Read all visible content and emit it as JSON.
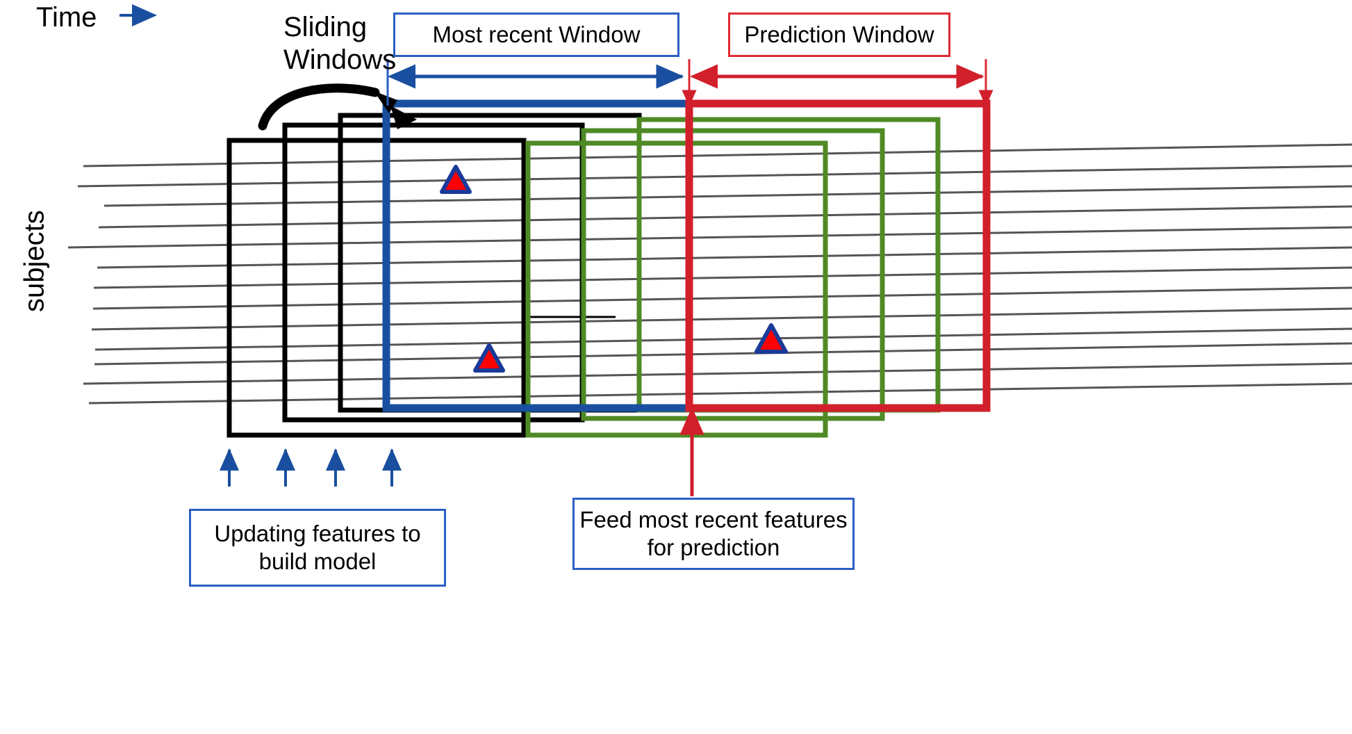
{
  "diagram": {
    "title_labels": {
      "time": "Time",
      "sliding_windows": "Sliding\nWindows",
      "subjects": "subjects"
    },
    "callout_boxes": [
      {
        "id": "most-recent-window",
        "text": "Most recent Window",
        "border_color": "#2b5ec4"
      },
      {
        "id": "prediction-window",
        "text": "Prediction Window",
        "border_color": "#e02a32"
      },
      {
        "id": "updating-features",
        "text": "Updating features\nto build model",
        "border_color": "#2b5ec4"
      },
      {
        "id": "feed-most-recent",
        "text": "Feed most recent\nfeatures for prediction",
        "border_color": "#2b5ec4"
      }
    ],
    "colors": {
      "blue": "#1a4fa0",
      "blue_accent": "#2b5ec4",
      "red": "#d11f2b",
      "red_accent": "#e02a32",
      "green": "#4f8a25",
      "black": "#000000",
      "line_gray": "#555555",
      "triangle_fill": "#ff0000",
      "triangle_stroke": "#1a3a99"
    },
    "subject_lines": {
      "count": 13,
      "description": "horizontal time-series tracks, one per subject"
    },
    "windows": [
      {
        "id": "black-window-1",
        "color": "#000000",
        "role": "training sliding window"
      },
      {
        "id": "black-window-2",
        "color": "#000000",
        "role": "training sliding window"
      },
      {
        "id": "black-window-3",
        "color": "#000000",
        "role": "training sliding window"
      },
      {
        "id": "blue-window",
        "color": "#1a4fa0",
        "role": "most recent window"
      },
      {
        "id": "green-window-1",
        "color": "#4f8a25",
        "role": "label window"
      },
      {
        "id": "green-window-2",
        "color": "#4f8a25",
        "role": "label window"
      },
      {
        "id": "green-window-3",
        "color": "#4f8a25",
        "role": "label window"
      },
      {
        "id": "red-window",
        "color": "#d11f2b",
        "role": "prediction window"
      }
    ],
    "event_markers": {
      "shape": "triangle",
      "count": 3,
      "fill": "#ff0000",
      "stroke": "#1a3a99"
    },
    "arrows": {
      "time_arrow": "rightward blue arrow next to Time label",
      "most_recent_span": "double-headed blue arrow spanning most recent window",
      "prediction_span": "double-headed red arrow spanning prediction window",
      "sliding_curve": "curved black arrow indicating window slide",
      "update_arrows_count": 4,
      "feed_arrow": "upward red arrow from Feed most recent features box"
    }
  }
}
